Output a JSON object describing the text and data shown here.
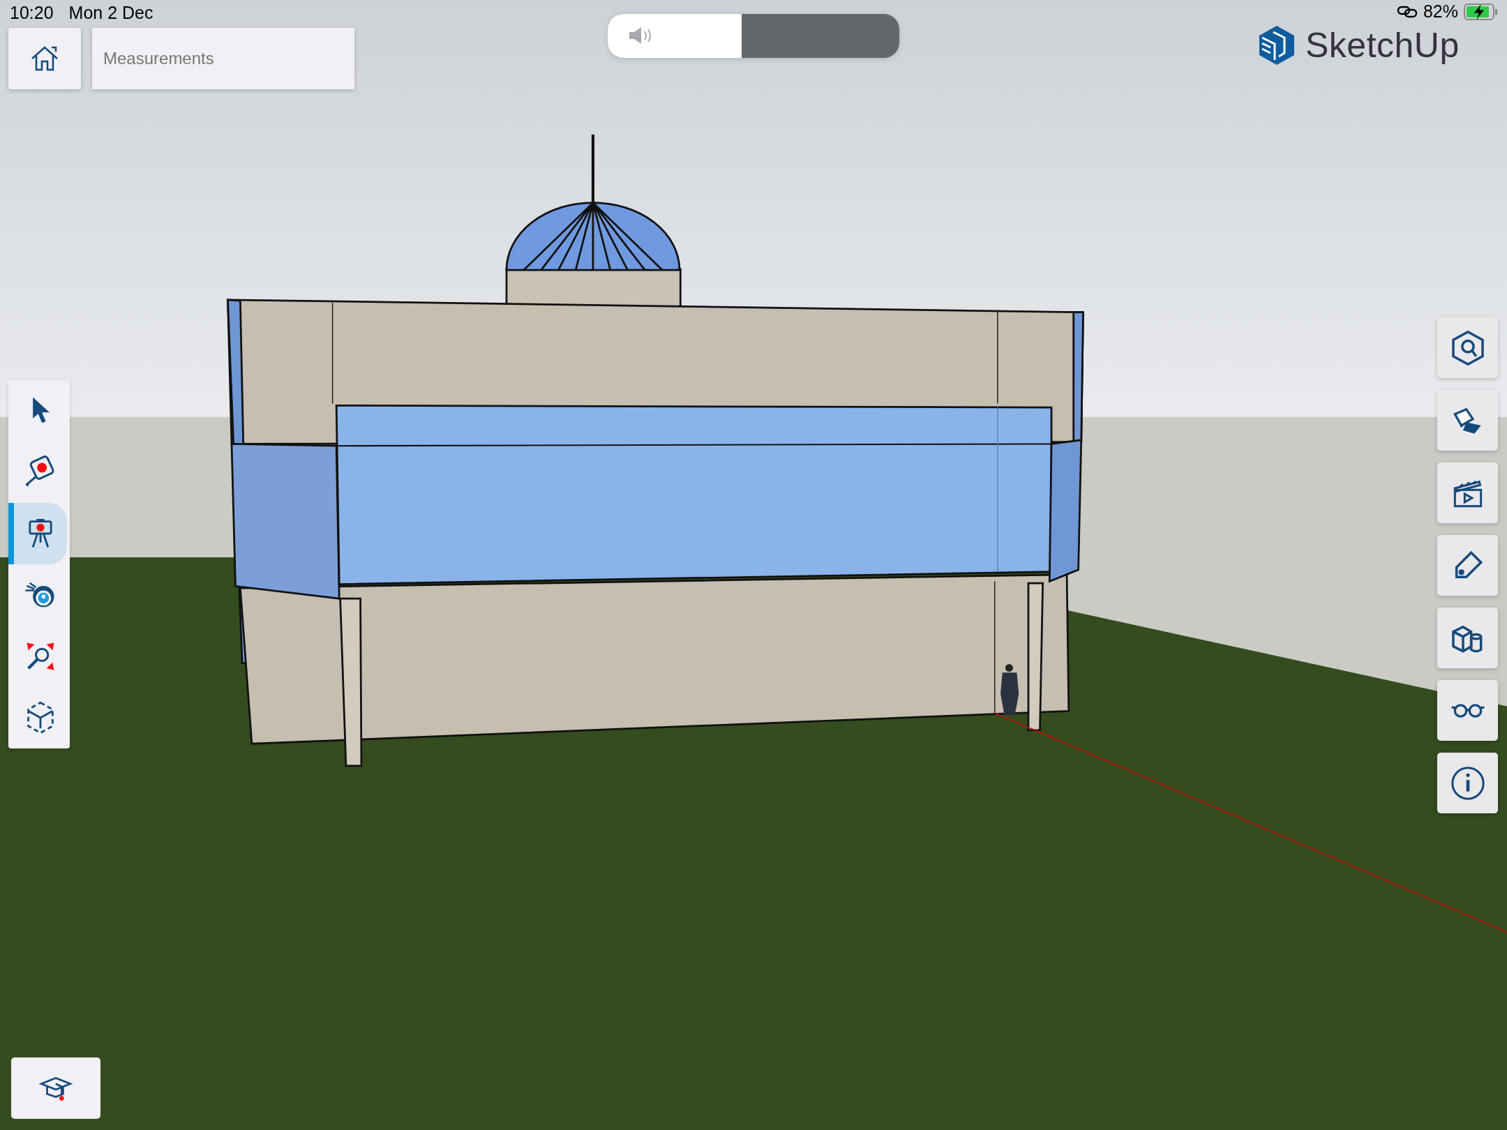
{
  "status_bar": {
    "time": "10:20",
    "date": "Mon 2 Dec",
    "battery": "82%",
    "charging": true
  },
  "home_button": {
    "kind": "home"
  },
  "measurements_field": {
    "placeholder": "Measurements"
  },
  "volume": {
    "level": 0.46
  },
  "logo": {
    "text": "SketchUp"
  },
  "left_toolbar": {
    "items": [
      {
        "kind": "select",
        "selected": false
      },
      {
        "kind": "tape",
        "selected": false
      },
      {
        "kind": "position-camera",
        "selected": true
      },
      {
        "kind": "look-around",
        "selected": false
      },
      {
        "kind": "zoom",
        "selected": false
      },
      {
        "kind": "orbit",
        "selected": false
      }
    ]
  },
  "right_panel": {
    "buttons": [
      {
        "kind": "search-model"
      },
      {
        "kind": "styles"
      },
      {
        "kind": "scenes"
      },
      {
        "kind": "tags"
      },
      {
        "kind": "components"
      },
      {
        "kind": "glasses"
      },
      {
        "kind": "info"
      }
    ]
  },
  "instructor_button": {
    "kind": "cap"
  }
}
